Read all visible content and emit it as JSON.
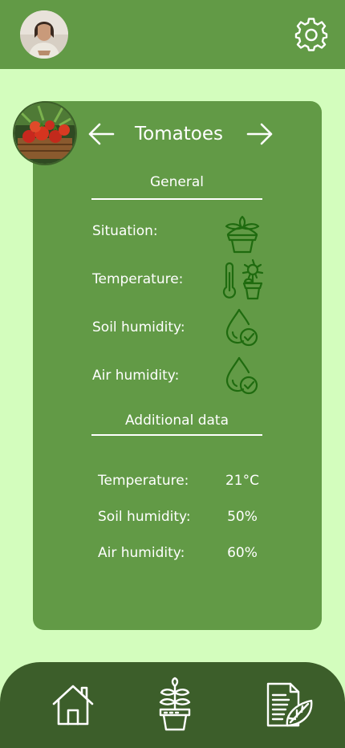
{
  "header": {
    "avatar_icon": "user-avatar",
    "settings_icon": "gear-icon"
  },
  "plant": {
    "name": "Tomatoes",
    "photo_icon": "tomato-basket-photo",
    "prev_icon": "arrow-left-icon",
    "next_icon": "arrow-right-icon"
  },
  "general": {
    "title": "General",
    "rows": [
      {
        "label": "Situation:",
        "icon": "plant-pot-icon"
      },
      {
        "label": "Temperature:",
        "icon": "thermometer-plant-icon"
      },
      {
        "label": "Soil humidity:",
        "icon": "water-drop-check-icon"
      },
      {
        "label": "Air humidity:",
        "icon": "water-drop-check-icon"
      }
    ]
  },
  "additional": {
    "title": "Additional data",
    "rows": [
      {
        "label": "Temperature:",
        "value": "21°C"
      },
      {
        "label": "Soil humidity:",
        "value": "50%"
      },
      {
        "label": "Air humidity:",
        "value": "60%"
      }
    ]
  },
  "nav": {
    "items": [
      {
        "icon": "home-icon"
      },
      {
        "icon": "plant-pot-icon"
      },
      {
        "icon": "document-leaf-icon"
      }
    ]
  },
  "colors": {
    "background": "#d3fdbd",
    "header": "#629a46",
    "card": "#629a46",
    "nav": "#3c5e2a",
    "icon_dark": "#1f6b0f"
  }
}
